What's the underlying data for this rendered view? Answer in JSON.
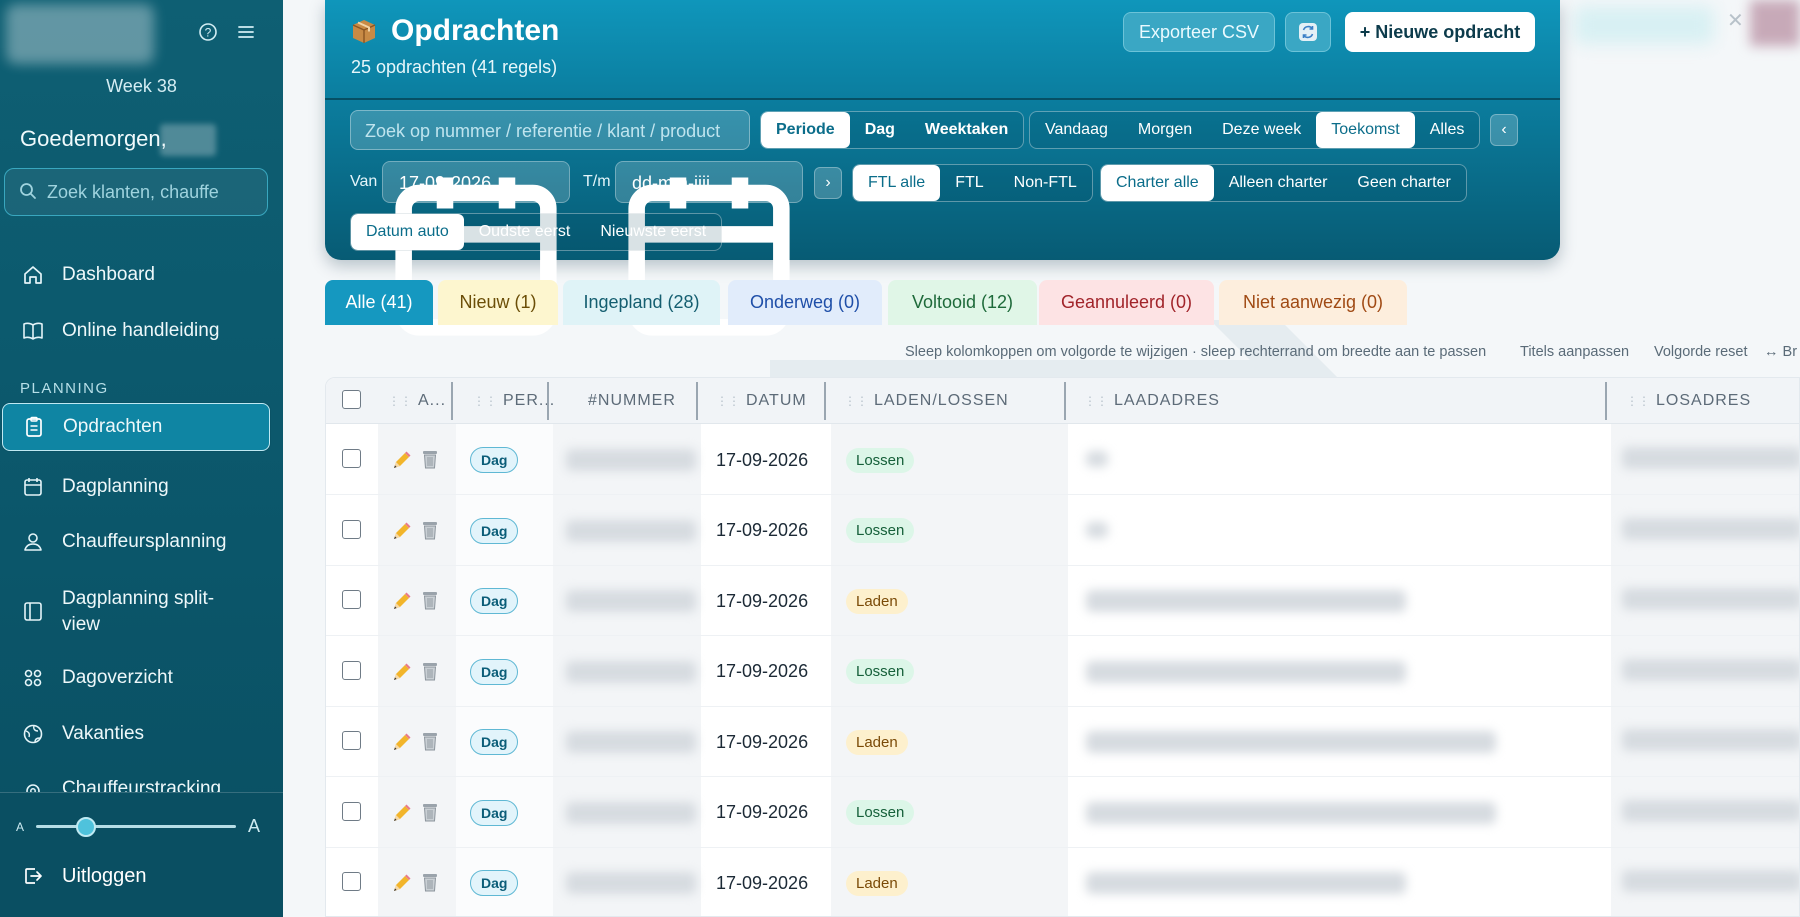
{
  "sidebar": {
    "week": "Week 38",
    "greeting": "Goedemorgen,",
    "search_placeholder": "Zoek klanten, chauffe",
    "section_planning": "PLANNING",
    "items": [
      {
        "label": "Dashboard",
        "icon": "home-icon"
      },
      {
        "label": "Online handleiding",
        "icon": "book-icon"
      },
      {
        "label": "Opdrachten",
        "icon": "clipboard-icon"
      },
      {
        "label": "Dagplanning",
        "icon": "calendar-icon"
      },
      {
        "label": "Chauffeursplanning",
        "icon": "driver-icon"
      },
      {
        "label": "Dagplanning split-view",
        "icon": "split-view-icon"
      },
      {
        "label": "Dagoverzicht",
        "icon": "grid-icon"
      },
      {
        "label": "Vakanties",
        "icon": "globe-icon"
      },
      {
        "label": "Chauffeurstracking",
        "icon": "location-icon"
      }
    ],
    "font_small": "A",
    "font_large": "A",
    "font_scale": 0.25,
    "logout": "Uitloggen"
  },
  "header": {
    "title": "Opdrachten",
    "subtitle": "25 opdrachten (41 regels)",
    "export_label": "Exporteer CSV",
    "new_label": "+ Nieuwe opdracht",
    "search_placeholder": "Zoek op nummer / referentie / klant / product",
    "mode_options": [
      "Periode",
      "Dag",
      "Weektaken"
    ],
    "mode_selected": "Periode",
    "range_options": [
      "Vandaag",
      "Morgen",
      "Deze week",
      "Toekomst",
      "Alles"
    ],
    "range_selected": "Toekomst",
    "prev_label": "‹",
    "next_label": "›",
    "from_label": "Van",
    "from_value": "17-09-2026",
    "to_label": "T/m",
    "to_value": "dd-mm-jjjj",
    "ftl_options": [
      "FTL alle",
      "FTL",
      "Non-FTL"
    ],
    "ftl_selected": "FTL alle",
    "charter_options": [
      "Charter alle",
      "Alleen charter",
      "Geen charter"
    ],
    "charter_selected": "Charter alle",
    "sort_options": [
      "Datum auto",
      "Oudste eerst",
      "Nieuwste eerst"
    ],
    "sort_selected": "Datum auto"
  },
  "tabs": [
    {
      "label": "Alle (41)",
      "bg": "#1598c0",
      "fg": "#ffffff"
    },
    {
      "label": "Nieuw (1)",
      "bg": "#fdf6cf",
      "fg": "#6b4e07"
    },
    {
      "label": "Ingepland (28)",
      "bg": "#dff3f7",
      "fg": "#145e70"
    },
    {
      "label": "Onderweg (0)",
      "bg": "#e1ecfb",
      "fg": "#1f4fa8"
    },
    {
      "label": "Voltooid (12)",
      "bg": "#e0f6e7",
      "fg": "#1e6a3a"
    },
    {
      "label": "Geannuleerd (0)",
      "bg": "#fde3e4",
      "fg": "#a1242a"
    },
    {
      "label": "Niet aanwezig (0)",
      "bg": "#fdeedd",
      "fg": "#a04a14"
    }
  ],
  "hints": {
    "drag": "Sleep kolomkoppen om volgorde te wijzigen · sleep rechterrand om breedte aan te passen",
    "titles": "Titels aanpassen",
    "reset": "Volgorde reset",
    "extra": "↔ Br"
  },
  "table": {
    "columns": [
      "A...",
      "PER...",
      "#NUMMER",
      "DATUM",
      "LADEN/LOSSEN",
      "LAADADRES",
      "LOSADRES"
    ],
    "rows": [
      {
        "period": "Dag",
        "date": "17-09-2026",
        "type": "Lossen"
      },
      {
        "period": "Dag",
        "date": "17-09-2026",
        "type": "Lossen"
      },
      {
        "period": "Dag",
        "date": "17-09-2026",
        "type": "Laden"
      },
      {
        "period": "Dag",
        "date": "17-09-2026",
        "type": "Lossen"
      },
      {
        "period": "Dag",
        "date": "17-09-2026",
        "type": "Laden"
      },
      {
        "period": "Dag",
        "date": "17-09-2026",
        "type": "Lossen"
      },
      {
        "period": "Dag",
        "date": "17-09-2026",
        "type": "Laden"
      }
    ]
  },
  "colors": {
    "sidebar_bg": "#0b566a",
    "accent": "#0f85a3",
    "header_top": "#0f96bb"
  }
}
